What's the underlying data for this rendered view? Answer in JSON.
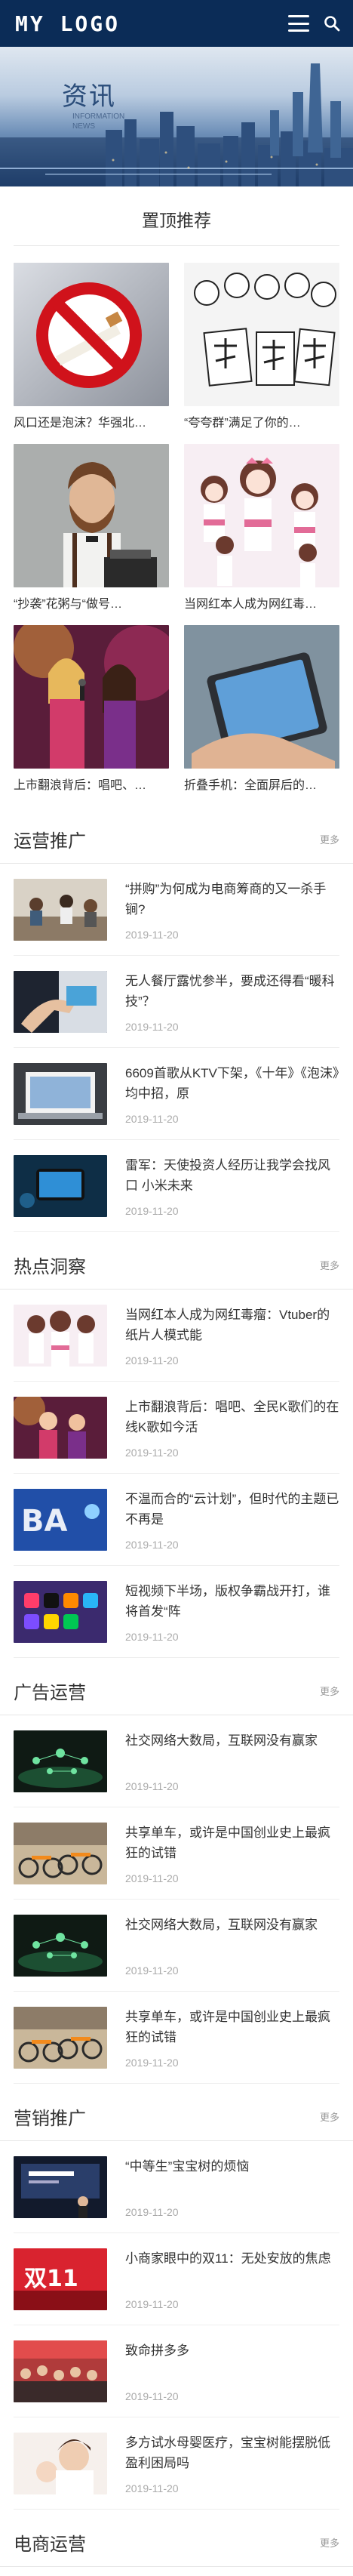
{
  "header": {
    "logo": "MY LOGO"
  },
  "banner": {
    "title": "资讯",
    "subtitle": "INFORMATION NEWS"
  },
  "top": {
    "title": "置顶推荐",
    "items": [
      {
        "caption": "风口还是泡沫？华强北…"
      },
      {
        "caption": "“夸夸群”满足了你的…"
      },
      {
        "caption": "“抄袭”花粥与“做号…"
      },
      {
        "caption": "当网红本人成为网红毒…"
      },
      {
        "caption": "上市翻浪背后：唱吧、…"
      },
      {
        "caption": "折叠手机：全面屏后的…"
      }
    ]
  },
  "more_label": "更多",
  "sections": [
    {
      "title": "运营推广",
      "items": [
        {
          "title": "“拼购”为何成为电商筹商的又一杀手锏?",
          "date": "2019-11-20"
        },
        {
          "title": "无人餐厅露忧参半，要成还得看“暖科技”？",
          "date": "2019-11-20"
        },
        {
          "title": "6609首歌从KTV下架，《十年》《泡沫》均中招，原",
          "date": "2019-11-20"
        },
        {
          "title": "雷军：天使投资人经历让我学会找风口 小米未来",
          "date": "2019-11-20"
        }
      ]
    },
    {
      "title": "热点洞察",
      "items": [
        {
          "title": "当网红本人成为网红毒瘤：Vtuber的纸片人模式能",
          "date": "2019-11-20"
        },
        {
          "title": "上市翻浪背后：唱吧、全民K歌们的在线K歌如今活",
          "date": "2019-11-20"
        },
        {
          "title": "不温而合的“云计划”，但时代的主题已不再是",
          "date": "2019-11-20"
        },
        {
          "title": "短视频下半场，版权争霸战开打，谁将首发“阵",
          "date": "2019-11-20"
        }
      ]
    },
    {
      "title": "广告运营",
      "items": [
        {
          "title": "社交网络大数局，互联网没有赢家",
          "date": "2019-11-20"
        },
        {
          "title": "共享单车，或许是中国创业史上最疯狂的试错",
          "date": "2019-11-20"
        },
        {
          "title": "社交网络大数局，互联网没有赢家",
          "date": "2019-11-20"
        },
        {
          "title": "共享单车，或许是中国创业史上最疯狂的试错",
          "date": "2019-11-20"
        }
      ]
    },
    {
      "title": "营销推广",
      "items": [
        {
          "title": "“中等生”宝宝树的烦恼",
          "date": "2019-11-20"
        },
        {
          "title": "小商家眼中的双11：无处安放的焦虑",
          "date": "2019-11-20"
        },
        {
          "title": "致命拼多多",
          "date": "2019-11-20"
        },
        {
          "title": "多方试水母婴医疗，宝宝树能摆脱低盈利困局吗",
          "date": "2019-11-20"
        }
      ]
    },
    {
      "title": "电商运营",
      "items": []
    }
  ],
  "colors": {
    "header_bg": "#0b2c57",
    "text": "#333333",
    "muted": "#aaaaaa"
  }
}
